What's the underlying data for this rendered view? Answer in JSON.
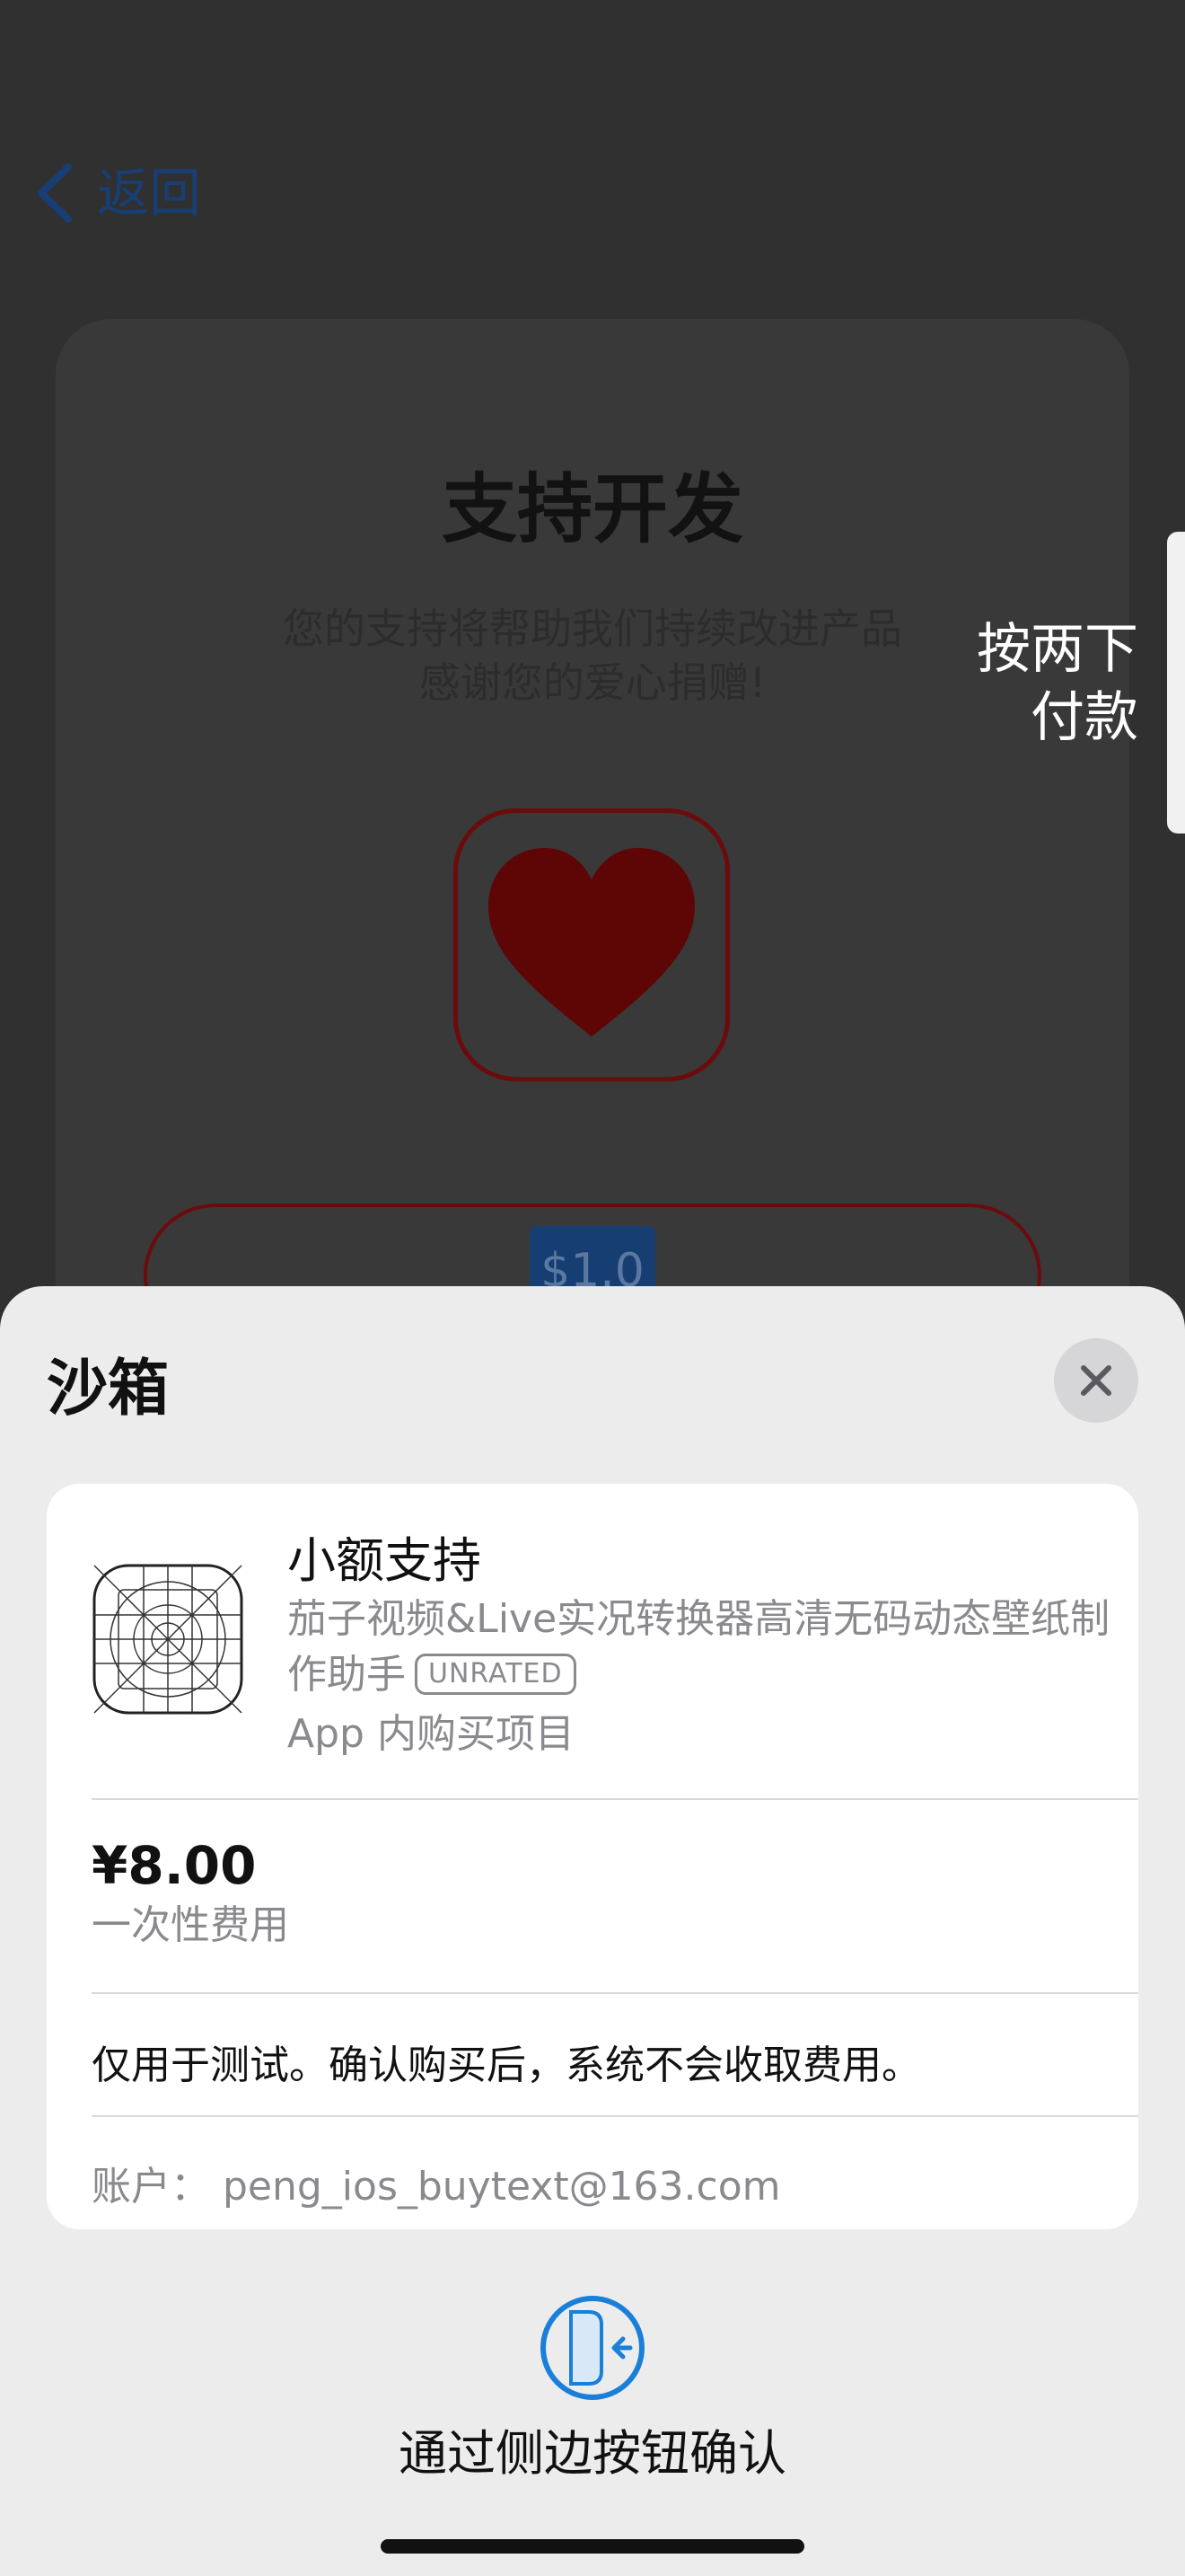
{
  "background_app": {
    "back_label": "返回",
    "title": "支持开发",
    "subtitle_lines": [
      "您的支持将帮助我们持续改进产品",
      "感谢您的爱心捐赠!"
    ],
    "price_tag": "$1.0",
    "accent_color": "#173f76",
    "heart_color": "#6c0b0b"
  },
  "side_hint": {
    "lines": [
      "按两下",
      "付款"
    ]
  },
  "sheet": {
    "title": "沙箱",
    "product": {
      "name": "小额支持",
      "app_name": "茄子视频&Live实况转换器高清无码动态壁纸制作助手",
      "rating": "UNRATED",
      "type": "App 内购买项目"
    },
    "price": "¥8.00",
    "price_note": "一次性费用",
    "test_note": "仅用于测试。确认购买后，系统不会收取费用。",
    "account": "账户： peng_ios_buytext@163.com",
    "confirm_label": "通过侧边按钮确认",
    "icons": [
      "close-icon",
      "app-placeholder-icon",
      "side-button-icon"
    ],
    "accent_color": "#1a7fd8"
  }
}
